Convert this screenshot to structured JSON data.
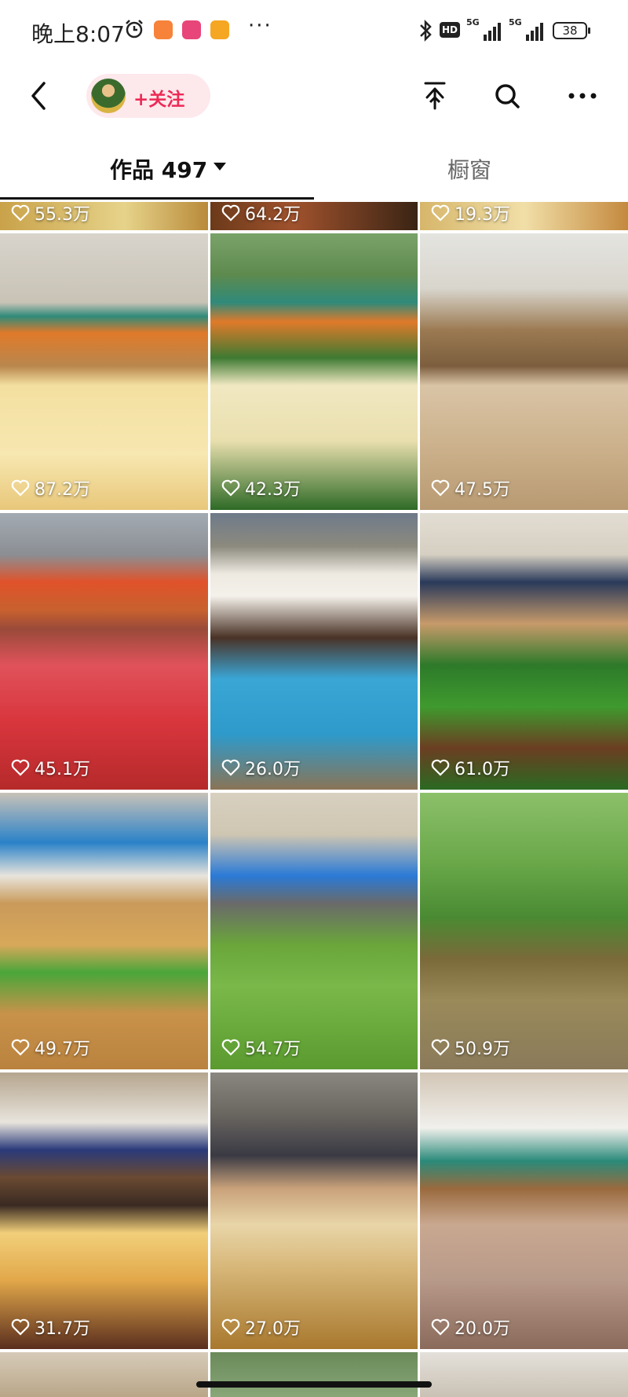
{
  "status_bar": {
    "time": "晚上8:07",
    "hd": "HD",
    "network_1": "5G",
    "network_2": "5G",
    "battery": "38",
    "more": "···"
  },
  "header": {
    "follow_label": "+关注"
  },
  "tabs": {
    "works_label": "作品 497",
    "window_label": "橱窗"
  },
  "grid": {
    "rows": [
      {
        "likes": [
          "55.3万",
          "64.2万",
          "19.3万"
        ]
      },
      {
        "likes": [
          "87.2万",
          "42.3万",
          "47.5万"
        ]
      },
      {
        "likes": [
          "45.1万",
          "26.0万",
          "61.0万"
        ]
      },
      {
        "likes": [
          "49.7万",
          "54.7万",
          "50.9万"
        ]
      },
      {
        "likes": [
          "31.7万",
          "27.0万",
          "20.0万"
        ]
      }
    ]
  },
  "colors": {
    "follow_pink": "#ec2a55",
    "follow_bg": "#fde8ec"
  }
}
